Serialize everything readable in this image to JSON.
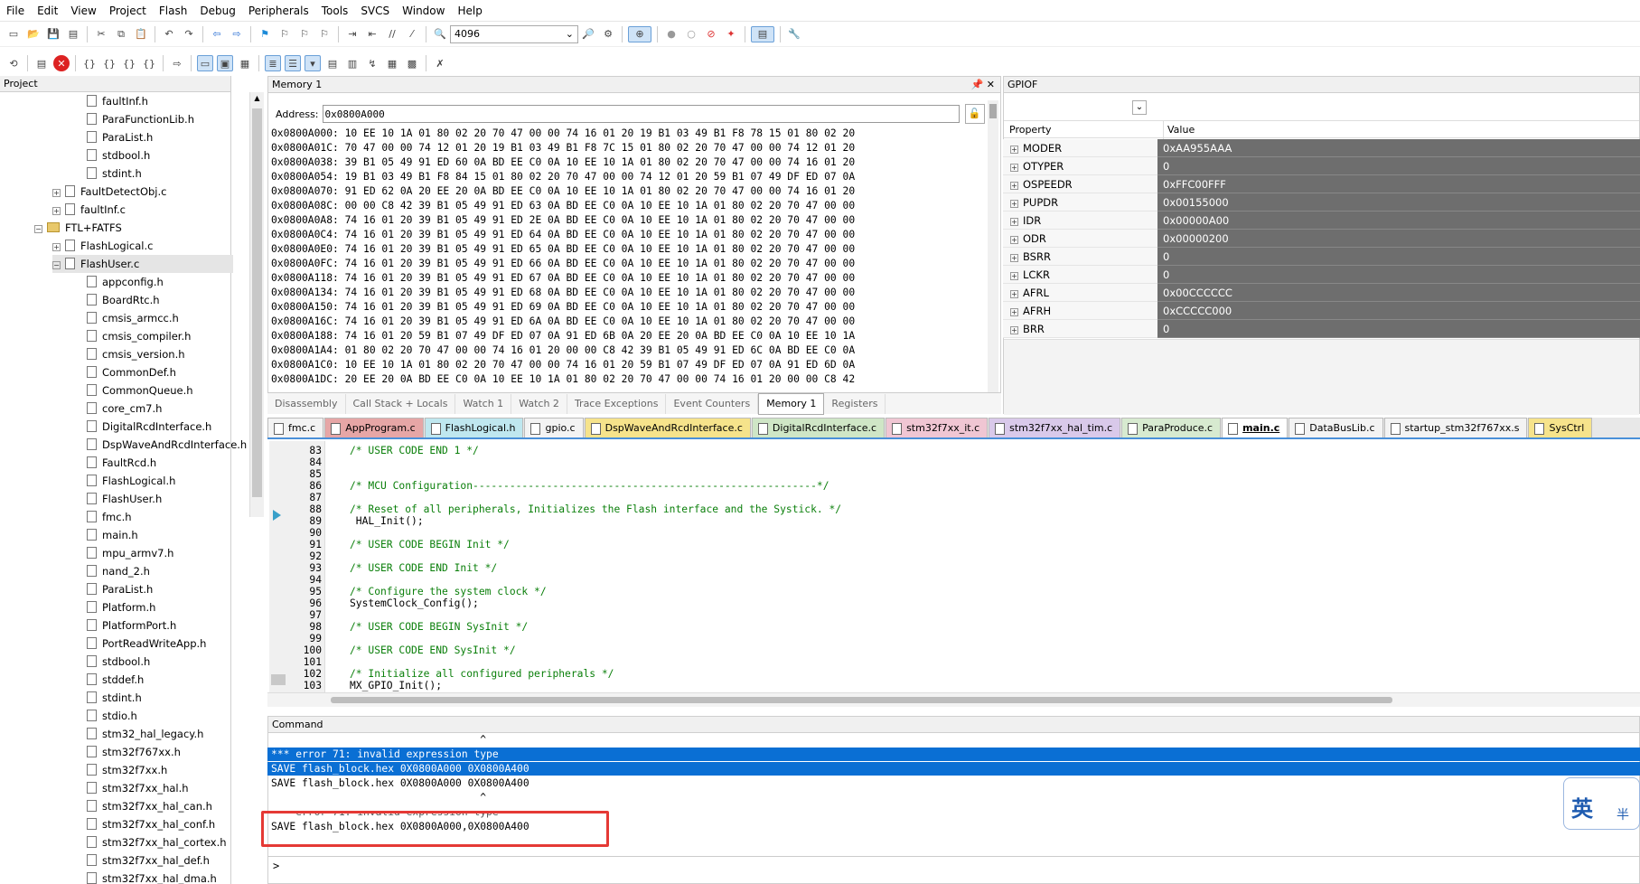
{
  "menu": [
    "File",
    "Edit",
    "View",
    "Project",
    "Flash",
    "Debug",
    "Peripherals",
    "Tools",
    "SVCS",
    "Window",
    "Help"
  ],
  "toolbar": {
    "combo_value": "4096"
  },
  "project": {
    "title": "Project",
    "tree": [
      {
        "label": "faultInf.h",
        "indent": 3,
        "type": "file"
      },
      {
        "label": "ParaFunctionLib.h",
        "indent": 3,
        "type": "file"
      },
      {
        "label": "ParaList.h",
        "indent": 3,
        "type": "file"
      },
      {
        "label": "stdbool.h",
        "indent": 3,
        "type": "file"
      },
      {
        "label": "stdint.h",
        "indent": 3,
        "type": "file"
      },
      {
        "label": "FaultDetectObj.c",
        "indent": 2,
        "type": "file",
        "expander": "+"
      },
      {
        "label": "faultInf.c",
        "indent": 2,
        "type": "file",
        "expander": "+"
      },
      {
        "label": "FTL+FATFS",
        "indent": 1,
        "type": "folder",
        "expander": "-"
      },
      {
        "label": "FlashLogical.c",
        "indent": 2,
        "type": "file",
        "expander": "+"
      },
      {
        "label": "FlashUser.c",
        "indent": 2,
        "type": "file",
        "expander": "-"
      },
      {
        "label": "appconfig.h",
        "indent": 3,
        "type": "file"
      },
      {
        "label": "BoardRtc.h",
        "indent": 3,
        "type": "file"
      },
      {
        "label": "cmsis_armcc.h",
        "indent": 3,
        "type": "file"
      },
      {
        "label": "cmsis_compiler.h",
        "indent": 3,
        "type": "file"
      },
      {
        "label": "cmsis_version.h",
        "indent": 3,
        "type": "file"
      },
      {
        "label": "CommonDef.h",
        "indent": 3,
        "type": "file"
      },
      {
        "label": "CommonQueue.h",
        "indent": 3,
        "type": "file"
      },
      {
        "label": "core_cm7.h",
        "indent": 3,
        "type": "file"
      },
      {
        "label": "DigitalRcdInterface.h",
        "indent": 3,
        "type": "file"
      },
      {
        "label": "DspWaveAndRcdInterface.h",
        "indent": 3,
        "type": "file"
      },
      {
        "label": "FaultRcd.h",
        "indent": 3,
        "type": "file"
      },
      {
        "label": "FlashLogical.h",
        "indent": 3,
        "type": "file"
      },
      {
        "label": "FlashUser.h",
        "indent": 3,
        "type": "file"
      },
      {
        "label": "fmc.h",
        "indent": 3,
        "type": "file"
      },
      {
        "label": "main.h",
        "indent": 3,
        "type": "file"
      },
      {
        "label": "mpu_armv7.h",
        "indent": 3,
        "type": "file"
      },
      {
        "label": "nand_2.h",
        "indent": 3,
        "type": "file"
      },
      {
        "label": "ParaList.h",
        "indent": 3,
        "type": "file"
      },
      {
        "label": "Platform.h",
        "indent": 3,
        "type": "file"
      },
      {
        "label": "PlatformPort.h",
        "indent": 3,
        "type": "file"
      },
      {
        "label": "PortReadWriteApp.h",
        "indent": 3,
        "type": "file"
      },
      {
        "label": "stdbool.h",
        "indent": 3,
        "type": "file"
      },
      {
        "label": "stddef.h",
        "indent": 3,
        "type": "file"
      },
      {
        "label": "stdint.h",
        "indent": 3,
        "type": "file"
      },
      {
        "label": "stdio.h",
        "indent": 3,
        "type": "file"
      },
      {
        "label": "stm32_hal_legacy.h",
        "indent": 3,
        "type": "file"
      },
      {
        "label": "stm32f767xx.h",
        "indent": 3,
        "type": "file"
      },
      {
        "label": "stm32f7xx.h",
        "indent": 3,
        "type": "file"
      },
      {
        "label": "stm32f7xx_hal.h",
        "indent": 3,
        "type": "file"
      },
      {
        "label": "stm32f7xx_hal_can.h",
        "indent": 3,
        "type": "file"
      },
      {
        "label": "stm32f7xx_hal_conf.h",
        "indent": 3,
        "type": "file"
      },
      {
        "label": "stm32f7xx_hal_cortex.h",
        "indent": 3,
        "type": "file"
      },
      {
        "label": "stm32f7xx_hal_def.h",
        "indent": 3,
        "type": "file"
      },
      {
        "label": "stm32f7xx_hal_dma.h",
        "indent": 3,
        "type": "file"
      }
    ]
  },
  "memory": {
    "title": "Memory 1",
    "address_label": "Address:",
    "address_value": "0x0800A000",
    "lines": [
      "0x0800A000: 10 EE 10 1A 01 80 02 20 70 47 00 00 74 16 01 20 19 B1 03 49 B1 F8 78 15 01 80 02 20",
      "0x0800A01C: 70 47 00 00 74 12 01 20 19 B1 03 49 B1 F8 7C 15 01 80 02 20 70 47 00 00 74 12 01 20",
      "0x0800A038: 39 B1 05 49 91 ED 60 0A BD EE C0 0A 10 EE 10 1A 01 80 02 20 70 47 00 00 74 16 01 20",
      "0x0800A054: 19 B1 03 49 B1 F8 84 15 01 80 02 20 70 47 00 00 74 12 01 20 59 B1 07 49 DF ED 07 0A",
      "0x0800A070: 91 ED 62 0A 20 EE 20 0A BD EE C0 0A 10 EE 10 1A 01 80 02 20 70 47 00 00 74 16 01 20",
      "0x0800A08C: 00 00 C8 42 39 B1 05 49 91 ED 63 0A BD EE C0 0A 10 EE 10 1A 01 80 02 20 70 47 00 00",
      "0x0800A0A8: 74 16 01 20 39 B1 05 49 91 ED 2E 0A BD EE C0 0A 10 EE 10 1A 01 80 02 20 70 47 00 00",
      "0x0800A0C4: 74 16 01 20 39 B1 05 49 91 ED 64 0A BD EE C0 0A 10 EE 10 1A 01 80 02 20 70 47 00 00",
      "0x0800A0E0: 74 16 01 20 39 B1 05 49 91 ED 65 0A BD EE C0 0A 10 EE 10 1A 01 80 02 20 70 47 00 00",
      "0x0800A0FC: 74 16 01 20 39 B1 05 49 91 ED 66 0A BD EE C0 0A 10 EE 10 1A 01 80 02 20 70 47 00 00",
      "0x0800A118: 74 16 01 20 39 B1 05 49 91 ED 67 0A BD EE C0 0A 10 EE 10 1A 01 80 02 20 70 47 00 00",
      "0x0800A134: 74 16 01 20 39 B1 05 49 91 ED 68 0A BD EE C0 0A 10 EE 10 1A 01 80 02 20 70 47 00 00",
      "0x0800A150: 74 16 01 20 39 B1 05 49 91 ED 69 0A BD EE C0 0A 10 EE 10 1A 01 80 02 20 70 47 00 00",
      "0x0800A16C: 74 16 01 20 39 B1 05 49 91 ED 6A 0A BD EE C0 0A 10 EE 10 1A 01 80 02 20 70 47 00 00",
      "0x0800A188: 74 16 01 20 59 B1 07 49 DF ED 07 0A 91 ED 6B 0A 20 EE 20 0A BD EE C0 0A 10 EE 10 1A",
      "0x0800A1A4: 01 80 02 20 70 47 00 00 74 16 01 20 00 00 C8 42 39 B1 05 49 91 ED 6C 0A BD EE C0 0A",
      "0x0800A1C0: 10 EE 10 1A 01 80 02 20 70 47 00 00 74 16 01 20 59 B1 07 49 DF ED 07 0A 91 ED 6D 0A",
      "0x0800A1DC: 20 EE 20 0A BD EE C0 0A 10 EE 10 1A 01 80 02 20 70 47 00 00 74 16 01 20 00 00 C8 42"
    ]
  },
  "debug_tabs": [
    "Disassembly",
    "Call Stack + Locals",
    "Watch 1",
    "Watch 2",
    "Trace Exceptions",
    "Event Counters",
    "Memory 1",
    "Registers"
  ],
  "debug_active": "Memory 1",
  "gpiof": {
    "title": "GPIOF",
    "col_property": "Property",
    "col_value": "Value",
    "rows": [
      {
        "name": "MODER",
        "value": "0xAA955AAA"
      },
      {
        "name": "OTYPER",
        "value": "0"
      },
      {
        "name": "OSPEEDR",
        "value": "0xFFC00FFF"
      },
      {
        "name": "PUPDR",
        "value": "0x00155000"
      },
      {
        "name": "IDR",
        "value": "0x00000A00"
      },
      {
        "name": "ODR",
        "value": "0x00000200"
      },
      {
        "name": "BSRR",
        "value": "0"
      },
      {
        "name": "LCKR",
        "value": "0"
      },
      {
        "name": "AFRL",
        "value": "0x00CCCCCC"
      },
      {
        "name": "AFRH",
        "value": "0xCCCCC000"
      },
      {
        "name": "BRR",
        "value": "0"
      }
    ]
  },
  "file_tabs": [
    {
      "label": "fmc.c",
      "color": "#f3f3f3"
    },
    {
      "label": "AppProgram.c",
      "color": "#e6a6a6"
    },
    {
      "label": "FlashLogical.h",
      "color": "#bfe7ef"
    },
    {
      "label": "gpio.c",
      "color": "#f3f3f3"
    },
    {
      "label": "DspWaveAndRcdInterface.c",
      "color": "#f6e38b"
    },
    {
      "label": "DigitalRcdInterface.c",
      "color": "#cfe6c6"
    },
    {
      "label": "stm32f7xx_it.c",
      "color": "#f0c6d3"
    },
    {
      "label": "stm32f7xx_hal_tim.c",
      "color": "#d9c9ea"
    },
    {
      "label": "ParaProduce.c",
      "color": "#d7ead0"
    },
    {
      "label": "main.c",
      "color": "#ffffff",
      "active": true
    },
    {
      "label": "DataBusLib.c",
      "color": "#f3f3f3"
    },
    {
      "label": "startup_stm32f767xx.s",
      "color": "#f3f3f3"
    },
    {
      "label": "SysCtrl",
      "color": "#f6e38b"
    }
  ],
  "editor": {
    "lines": [
      {
        "n": "83",
        "t": "/* USER CODE END 1 */",
        "c": true
      },
      {
        "n": "84",
        "t": ""
      },
      {
        "n": "85",
        "t": ""
      },
      {
        "n": "86",
        "t": "/* MCU Configuration--------------------------------------------------------*/",
        "c": true
      },
      {
        "n": "87",
        "t": ""
      },
      {
        "n": "88",
        "t": "/* Reset of all peripherals, Initializes the Flash interface and the Systick. */",
        "c": true
      },
      {
        "n": "89",
        "t": " HAL_Init();"
      },
      {
        "n": "90",
        "t": ""
      },
      {
        "n": "91",
        "t": "/* USER CODE BEGIN Init */",
        "c": true
      },
      {
        "n": "92",
        "t": ""
      },
      {
        "n": "93",
        "t": "/* USER CODE END Init */",
        "c": true
      },
      {
        "n": "94",
        "t": ""
      },
      {
        "n": "95",
        "t": "/* Configure the system clock */",
        "c": true
      },
      {
        "n": "96",
        "t": "SystemClock_Config();"
      },
      {
        "n": "97",
        "t": ""
      },
      {
        "n": "98",
        "t": "/* USER CODE BEGIN SysInit */",
        "c": true
      },
      {
        "n": "99",
        "t": ""
      },
      {
        "n": "100",
        "t": "/* USER CODE END SysInit */",
        "c": true
      },
      {
        "n": "101",
        "t": ""
      },
      {
        "n": "102",
        "t": "/* Initialize all configured peripherals */",
        "c": true
      },
      {
        "n": "103",
        "t": "MX_GPIO_Init();"
      }
    ]
  },
  "command": {
    "title": "Command",
    "lines": [
      {
        "t": "                                  ^",
        "sel": false
      },
      {
        "t": "*** error 71: invalid expression type",
        "sel": true
      },
      {
        "t": "SAVE flash_block.hex 0X0800A000 0X0800A400",
        "sel": true
      },
      {
        "t": "SAVE flash_block.hex 0X0800A000 0X0800A400",
        "sel": false
      },
      {
        "t": "                                  ^",
        "sel": false
      },
      {
        "t": "*** error 71: invalid expression type",
        "sel": false
      },
      {
        "t": "SAVE flash_block.hex 0X0800A000,0X0800A400",
        "sel": false
      }
    ],
    "prompt": ">"
  },
  "ime": {
    "char": "英",
    "sub": "半"
  },
  "colors": {
    "highlight": "#e53935",
    "selection": "#0a6fd4",
    "prop_value_bg": "#6e6e6e"
  }
}
